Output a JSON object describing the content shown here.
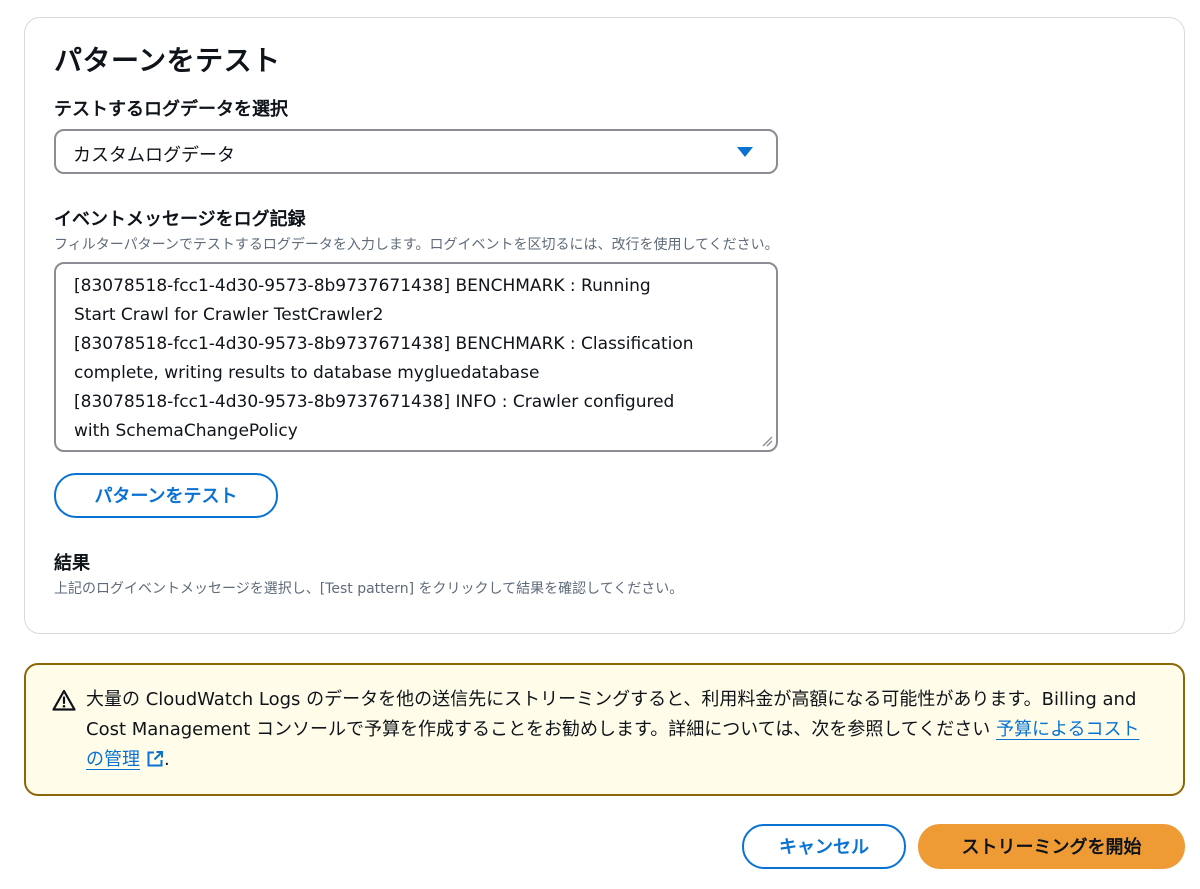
{
  "test_pattern": {
    "title": "パターンをテスト",
    "log_select": {
      "label": "テストするログデータを選択",
      "value": "カスタムログデータ"
    },
    "event_messages": {
      "label": "イベントメッセージをログ記録",
      "description": "フィルターパターンでテストするログデータを入力します。ログイベントを区切るには、改行を使用してください。",
      "lines": [
        "[83078518-fcc1-4d30-9573-8b9737671438] BENCHMARK : Running",
        "Start Crawl for Crawler TestCrawler2",
        "[83078518-fcc1-4d30-9573-8b9737671438] BENCHMARK : Classification",
        "complete, writing results to database mygluedatabase",
        "[83078518-fcc1-4d30-9573-8b9737671438] INFO : Crawler configured",
        "with SchemaChangePolicy"
      ]
    },
    "test_button_label": "パターンをテスト",
    "results": {
      "label": "結果",
      "description": "上記のログイベントメッセージを選択し、[Test pattern] をクリックして結果を確認してください。"
    }
  },
  "warning": {
    "icon": "warning-triangle-icon",
    "text": "大量の CloudWatch Logs のデータを他の送信先にストリーミングすると、利用料金が高額になる可能性があります。Billing and Cost Management コンソールで予算を作成することをお勧めします。詳細については、次を参照してください ",
    "link_label": "予算によるコストの管理",
    "link_icon": "external-link-icon",
    "suffix": "."
  },
  "footer": {
    "cancel_label": "キャンセル",
    "start_label": "ストリーミングを開始"
  },
  "colors": {
    "accent": "#0972d3",
    "primary_button": "#ef9b35",
    "warning_border": "#8d6605",
    "warning_background": "#fffce9"
  }
}
